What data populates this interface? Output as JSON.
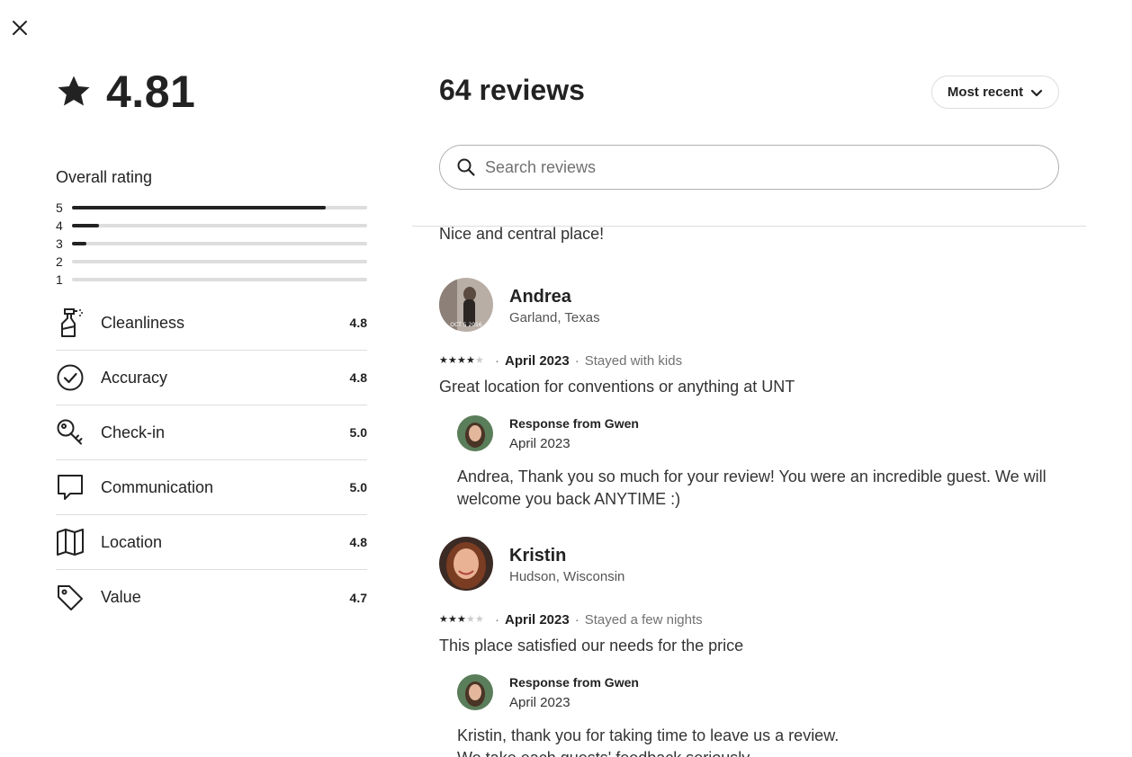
{
  "header": {
    "close_icon": "close-icon"
  },
  "summary": {
    "rating": "4.81",
    "overall_label": "Overall rating",
    "distribution": [
      {
        "label": "5",
        "fraction": 0.86
      },
      {
        "label": "4",
        "fraction": 0.09
      },
      {
        "label": "3",
        "fraction": 0.05
      },
      {
        "label": "2",
        "fraction": 0.0
      },
      {
        "label": "1",
        "fraction": 0.0
      }
    ],
    "categories": [
      {
        "label": "Cleanliness",
        "score": "4.8",
        "icon": "spray-bottle-icon"
      },
      {
        "label": "Accuracy",
        "score": "4.8",
        "icon": "check-circle-icon"
      },
      {
        "label": "Check-in",
        "score": "5.0",
        "icon": "key-icon"
      },
      {
        "label": "Communication",
        "score": "5.0",
        "icon": "chat-bubble-icon"
      },
      {
        "label": "Location",
        "score": "4.8",
        "icon": "map-icon"
      },
      {
        "label": "Value",
        "score": "4.7",
        "icon": "tag-icon"
      }
    ]
  },
  "reviews_panel": {
    "title": "64 reviews",
    "sort_label": "Most recent",
    "search_placeholder": "Search reviews",
    "partial_review_text": "Nice and central place!",
    "reviews": [
      {
        "name": "Andrea",
        "location": "Garland, Texas",
        "stars": 4,
        "date": "April 2023",
        "stay": "Stayed with kids",
        "text": "Great location for conventions or anything at UNT",
        "response": {
          "from": "Response from Gwen",
          "date": "April 2023",
          "text": "Andrea, Thank you so much for your review! You were an incredible guest. We will welcome you back ANYTIME :)"
        }
      },
      {
        "name": "Kristin",
        "location": "Hudson, Wisconsin",
        "stars": 3,
        "date": "April 2023",
        "stay": "Stayed a few nights",
        "text": "This place satisfied our needs for the price",
        "response": {
          "from": "Response from Gwen",
          "date": "April 2023",
          "text": "Kristin, thank you for taking time to leave us a review.\nWe take each guests' feedback seriously."
        }
      }
    ]
  },
  "colors": {
    "text": "#222222",
    "muted": "#717171",
    "border": "#dddddd",
    "bar_track": "#dddddd"
  }
}
